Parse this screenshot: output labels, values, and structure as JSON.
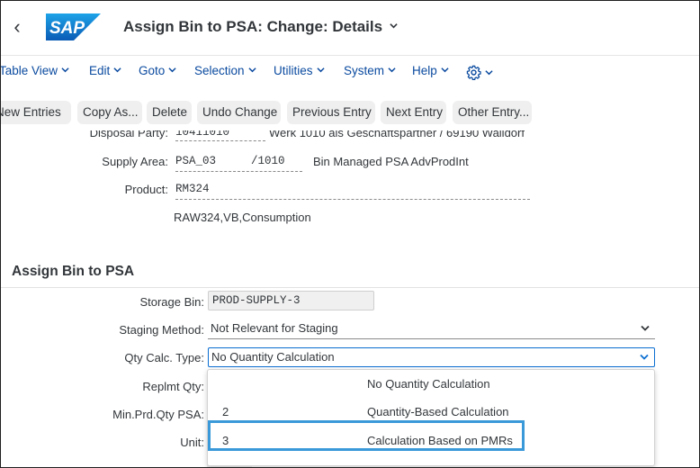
{
  "header": {
    "title": "Assign Bin to PSA: Change: Details",
    "logo_text": "SAP",
    "brand_color": "#0a6ed1"
  },
  "menu": {
    "items": [
      {
        "label": "Table View"
      },
      {
        "label": "Edit"
      },
      {
        "label": "Goto"
      },
      {
        "label": "Selection"
      },
      {
        "label": "Utilities"
      },
      {
        "label": "System"
      },
      {
        "label": "Help"
      }
    ],
    "settings_icon": "gear-icon"
  },
  "toolbar": {
    "buttons": [
      {
        "label": "New Entries"
      },
      {
        "label": "Copy As..."
      },
      {
        "label": "Delete"
      },
      {
        "label": "Undo Change"
      },
      {
        "label": "Previous Entry"
      },
      {
        "label": "Next Entry"
      },
      {
        "label": "Other Entry..."
      }
    ]
  },
  "header_fields": {
    "disposal_party": {
      "label": "Disposal Party:",
      "value": "10411010",
      "description": "Werk 1010 als Geschaftspartner / 69190 Walldorf"
    },
    "supply_area": {
      "label": "Supply Area:",
      "value": "PSA_03",
      "plant": "/1010",
      "description": "Bin Managed PSA AdvProdInt"
    },
    "product": {
      "label": "Product:",
      "value": "RM324",
      "description": "RAW324,VB,Consumption"
    }
  },
  "section": {
    "title": "Assign Bin to PSA",
    "fields": {
      "storage_bin": {
        "label": "Storage Bin:",
        "value": "PROD-SUPPLY-3"
      },
      "staging_method": {
        "label": "Staging Method:",
        "value": "Not Relevant for Staging"
      },
      "qty_calc_type": {
        "label": "Qty Calc. Type:",
        "value": "No Quantity Calculation"
      },
      "replmt_qty": {
        "label": "Replmt Qty:"
      },
      "min_prd_qty_psa": {
        "label": "Min.Prd.Qty PSA:"
      },
      "unit": {
        "label": "Unit:"
      }
    }
  },
  "dropdown": {
    "options": [
      {
        "key": "",
        "text": "No Quantity Calculation"
      },
      {
        "key": "2",
        "text": "Quantity-Based Calculation"
      },
      {
        "key": "3",
        "text": "Calculation Based on PMRs"
      }
    ],
    "highlight_color": "#3a9ad9"
  }
}
